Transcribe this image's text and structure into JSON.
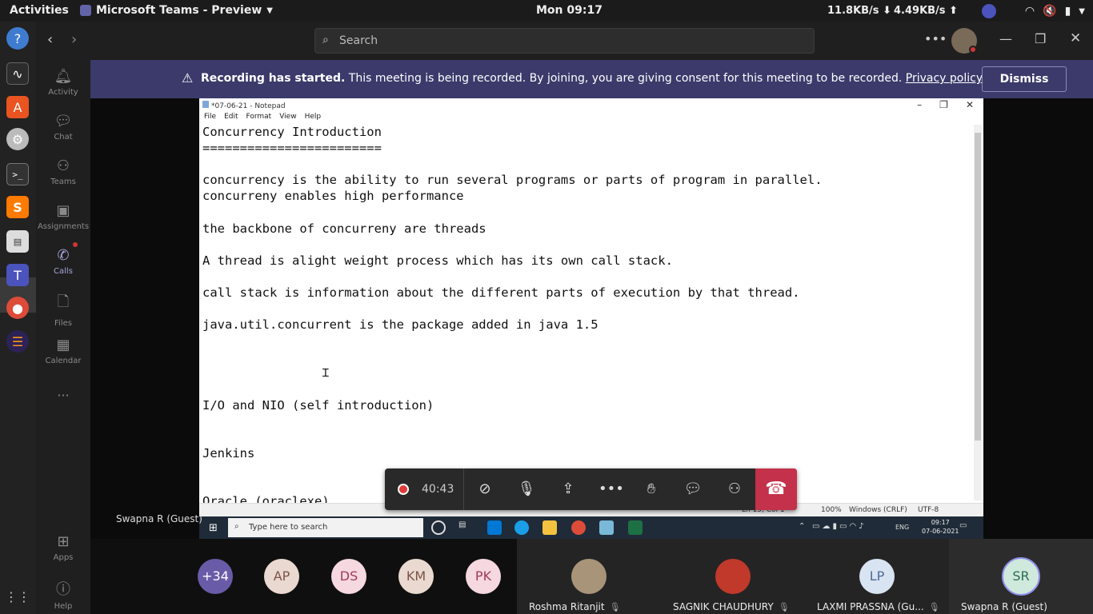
{
  "topbar": {
    "activities": "Activities",
    "app_menu": "Microsoft Teams - Preview",
    "clock": "Mon 09:17",
    "net_down": "11.8KB/s ⬇",
    "net_up": "4.49KB/s ⬆"
  },
  "teams": {
    "search_placeholder": "Search",
    "rail": [
      "Activity",
      "Chat",
      "Teams",
      "Assignments",
      "Calls",
      "Files",
      "Calendar",
      "Apps",
      "Help"
    ]
  },
  "banner": {
    "bold": "Recording has started.",
    "text": " This meeting is being recorded. By joining, you are giving consent for this meeting to be recorded. ",
    "link": "Privacy policy",
    "dismiss": "Dismiss"
  },
  "notepad": {
    "title": "*07-06-21 - Notepad",
    "menu": [
      "File",
      "Edit",
      "Format",
      "View",
      "Help"
    ],
    "lines": [
      "Concurrency Introduction",
      "========================",
      "",
      "concurrency is the ability to run several programs or parts of program in parallel.",
      "concurreny enables high performance",
      "",
      "the backbone of concurreny are threads",
      "",
      "A thread is alight weight process which has its own call stack.",
      "",
      "call stack is information about the different parts of execution by that thread.",
      "",
      "java.util.concurrent is the package added in java 1.5",
      "",
      "",
      "",
      "",
      "I/O and NIO (self introduction)",
      "",
      "",
      "Jenkins",
      "",
      "",
      "Oracle (oraclexe)"
    ],
    "status": {
      "position": "Ln 15, Col 1",
      "zoom": "100%",
      "eol": "Windows (CRLF)",
      "encoding": "UTF-8"
    }
  },
  "win_taskbar": {
    "search_placeholder": "Type here to search",
    "lang": "ENG",
    "time": "09:17",
    "date": "07-06-2021"
  },
  "controls": {
    "timer": "40:43"
  },
  "presenter": "Swapna R (Guest)",
  "participants": {
    "overflow": "+34",
    "initials": [
      "AP",
      "DS",
      "KM",
      "PK"
    ],
    "tiles": [
      {
        "name": "Roshma Ritanjit"
      },
      {
        "name": "SAGNIK CHAUDHURY"
      },
      {
        "name": "LAXMI PRASSNA (Gu...",
        "initials": "LP"
      },
      {
        "name": "Swapna R (Guest)",
        "initials": "SR"
      }
    ]
  },
  "colors": {
    "banner": "#3b3a6b",
    "hangup": "#c4314b",
    "teams_purple": "#6264a7"
  }
}
